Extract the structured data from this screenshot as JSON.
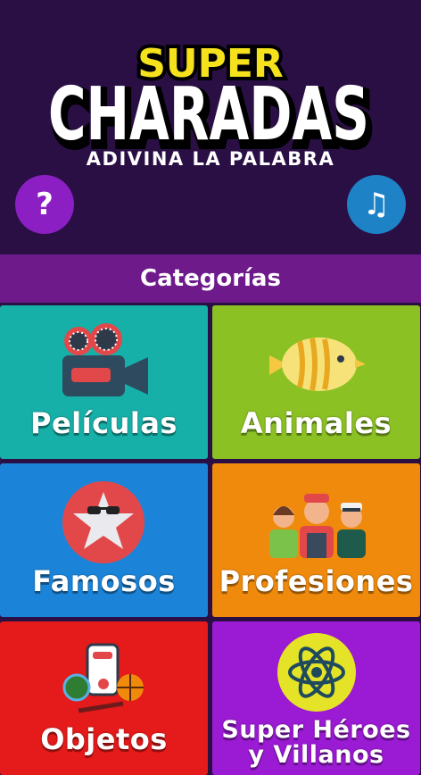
{
  "header": {
    "logo_top": "SUPER",
    "logo_main": "CHARADAS",
    "subtitle": "ADIVINA LA PALABRA",
    "help_symbol": "?",
    "music_symbol": "♫"
  },
  "category_bar": {
    "title": "Categorías"
  },
  "categories": [
    {
      "label": "Películas",
      "color": "#16b0a8",
      "icon": "movie-camera-icon"
    },
    {
      "label": "Animales",
      "color": "#8cc124",
      "icon": "fish-icon"
    },
    {
      "label": "Famosos",
      "color": "#1c84d8",
      "icon": "star-sunglasses-icon"
    },
    {
      "label": "Profesiones",
      "color": "#f08a0c",
      "icon": "professionals-icon"
    },
    {
      "label": "Objetos",
      "color": "#e51a1a",
      "icon": "objects-icon"
    },
    {
      "label": "Super Héroes y Villanos",
      "color": "#9b1ad3",
      "icon": "atom-icon"
    }
  ],
  "colors": {
    "background": "#2a0f45",
    "logo_yellow": "#f5e21c",
    "help_button": "#8c1fc4",
    "music_button": "#1d82c6",
    "category_bar": "#6e1a8b"
  }
}
